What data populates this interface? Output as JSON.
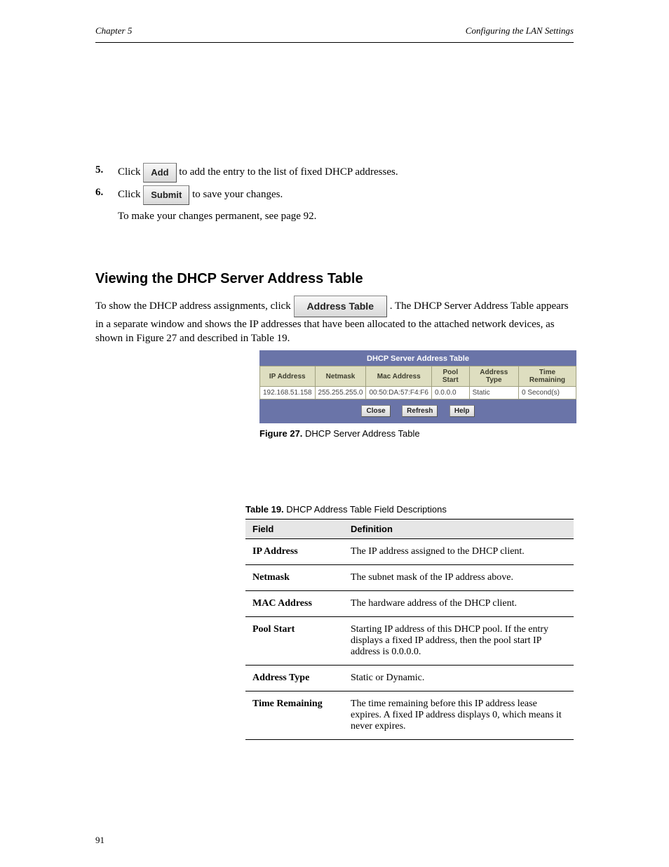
{
  "header": {
    "left": "Chapter 5",
    "right": "Configuring the LAN Settings"
  },
  "steps": {
    "s5": {
      "num": "5.",
      "text_before": "Click ",
      "btn": "Add",
      "text_after": " to add the entry to the list of fixed DHCP addresses."
    },
    "s6": {
      "num": "6.",
      "text_before": "Click ",
      "btn": "Submit",
      "text_after": " to save your changes.",
      "note": "To make your changes permanent, see page 92."
    }
  },
  "section": {
    "title": "Viewing the DHCP Server Address Table",
    "desc_before": "To show the DHCP address assignments, click ",
    "desc_btn": "Address Table",
    "desc_after": ". The DHCP Server Address Table appears in a separate window and shows the IP addresses that have been allocated to the attached network devices, as shown in Figure 27 and described in Table 19."
  },
  "figure": {
    "title": "DHCP Server Address Table",
    "headers": [
      "IP Address",
      "Netmask",
      "Mac Address",
      "Pool Start",
      "Address Type",
      "Time Remaining"
    ],
    "row": [
      "192.168.51.158",
      "255.255.255.0",
      "00:50:DA:57:F4:F6",
      "0.0.0.0",
      "Static",
      "0 Second(s)"
    ],
    "buttons": {
      "close": "Close",
      "refresh": "Refresh",
      "help": "Help"
    },
    "caption_bold": "Figure 27.",
    "caption_text": " DHCP Server Address Table"
  },
  "field_table": {
    "caption_bold": "Table 19.",
    "caption_text": " DHCP Address Table Field Descriptions",
    "head": [
      "Field",
      "Definition"
    ],
    "rows": [
      {
        "lbl": "IP Address",
        "val": "The IP address assigned to the DHCP client."
      },
      {
        "lbl": "Netmask",
        "val": "The subnet mask of the IP address above."
      },
      {
        "lbl": "MAC Address",
        "val": "The hardware address of the DHCP client."
      },
      {
        "lbl": "Pool Start",
        "val": "Starting IP address of this DHCP pool. If the entry displays a fixed IP address, then the pool start IP address is 0.0.0.0."
      },
      {
        "lbl": "Address Type",
        "val": "Static or Dynamic."
      },
      {
        "lbl": "Time Remaining",
        "val": "The time remaining before this IP address lease expires. A fixed IP address displays 0, which means it never expires."
      }
    ]
  },
  "page_number": "91"
}
